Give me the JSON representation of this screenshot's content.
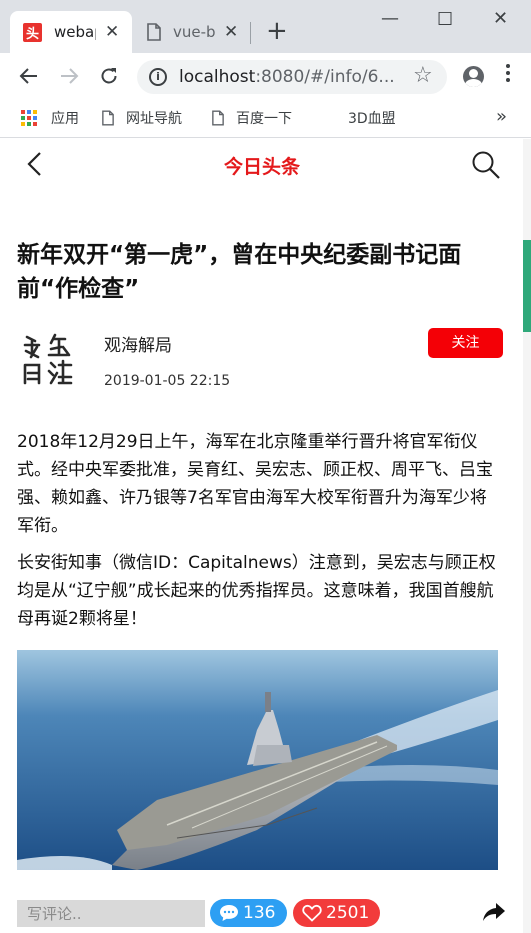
{
  "browser": {
    "tabs": [
      {
        "title": "webapp",
        "favicon_text": "头",
        "active": true
      },
      {
        "title": "vue-basic",
        "active": false
      }
    ],
    "url": {
      "host": "localhost",
      "rest": ":8080/#/info/6..."
    },
    "bookmarks": [
      {
        "label": "应用",
        "icon": "apps-icon"
      },
      {
        "label": "网址导航",
        "icon": "page-icon"
      },
      {
        "label": "百度一下",
        "icon": "page-icon"
      },
      {
        "label": "3D血盟",
        "icon": "none"
      }
    ],
    "more_label": "»"
  },
  "app": {
    "header_title": "今日头条",
    "accent_color": "#e4191b"
  },
  "article": {
    "title": "新年双开“第一虎”，曾在中央纪委副书记面前“作检查”",
    "author": "观海解局",
    "time": "2019-01-05 22:15",
    "follow_label": "关注",
    "logo_text": "观海解局",
    "paragraphs": [
      "2018年12月29日上午，海军在北京隆重举行晋升将官军衔仪式。经中央军委批准，吴育红、吴宏志、顾正权、周平飞、吕宝强、赖如鑫、许乃银等7名军官由海军大校军衔晋升为海军少将军衔。",
      "长安街知事（微信ID：Capitalnews）注意到，吴宏志与顾正权均是从“辽宁舰”成长起来的优秀指挥员。这意味着，我国首艘航母再诞2颗将星！"
    ],
    "image_subject": "aircraft-carrier-photo"
  },
  "bottom_bar": {
    "comment_placeholder": "写评论..",
    "comment_count": "136",
    "like_count": "2501",
    "comment_color": "#2d9ff3",
    "like_color": "#f23b3b"
  }
}
